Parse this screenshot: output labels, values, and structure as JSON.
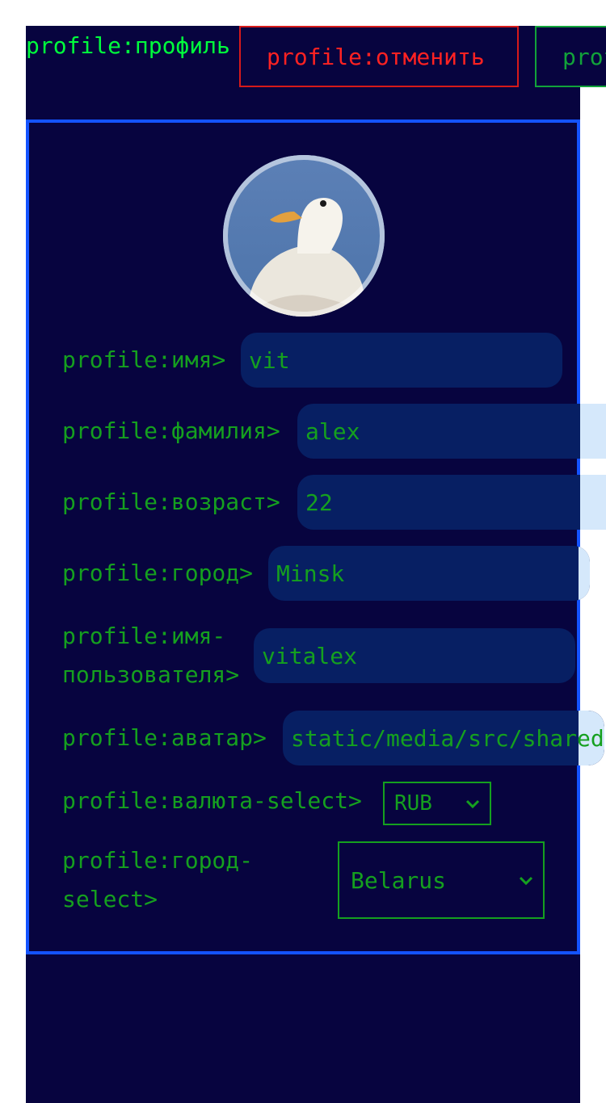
{
  "header": {
    "title": "profile:профиль",
    "cancel_label": "profile:отменить",
    "save_label": "profile:сохранить"
  },
  "form": {
    "name": {
      "label": "profile:имя>",
      "value": "vit"
    },
    "surname": {
      "label": "profile:фамилия>",
      "value": "alex"
    },
    "age": {
      "label": "profile:возраст>",
      "value": "22"
    },
    "city": {
      "label": "profile:город>",
      "value": "Minsk"
    },
    "username": {
      "label_line1": "profile:имя-",
      "label_line2": "пользователя>",
      "value": "vitalex"
    },
    "avatar": {
      "label": "profile:аватар>",
      "value": "static/media/src/shared"
    },
    "currency": {
      "label": "profile:валюта-select>",
      "selected": "RUB"
    },
    "country": {
      "label_line1": "profile:город-",
      "label_line2": "select>",
      "selected": "Belarus"
    }
  },
  "colors": {
    "background": "#07043f",
    "title": "#00ff3c",
    "text": "#15a01f",
    "cancel": "#ff2222",
    "card_border": "#1453ff",
    "input_bg": "#071f63"
  },
  "icons": {
    "avatar_image": "white-duck-photo",
    "select_arrow": "chevron-down-icon"
  }
}
